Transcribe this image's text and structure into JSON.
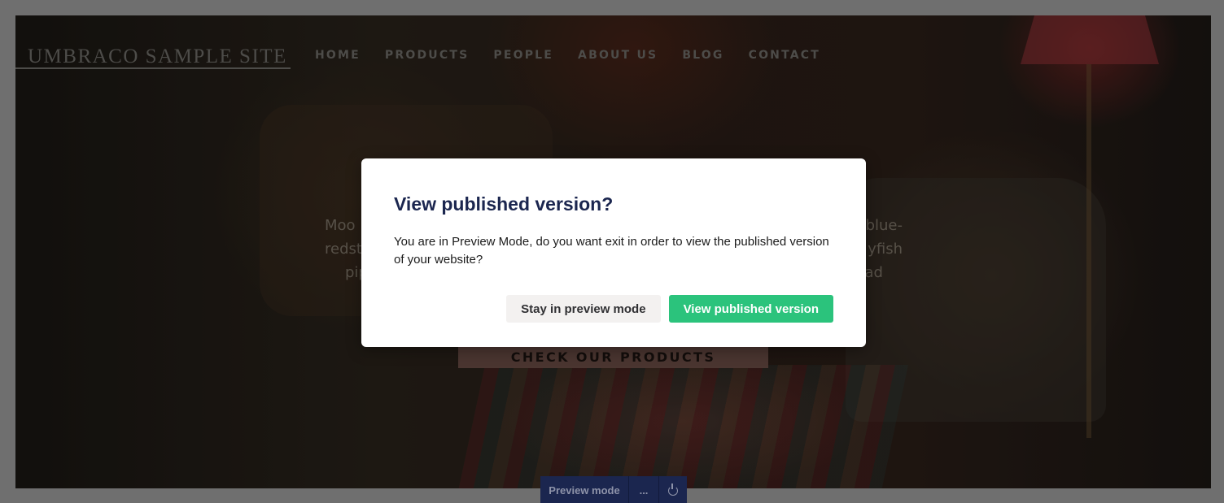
{
  "site": {
    "title": "UMBRACO SAMPLE SITE",
    "nav": [
      "HOME",
      "PRODUCTS",
      "PEOPLE",
      "ABOUT US",
      "BLOG",
      "CONTACT"
    ],
    "hero_text_line1_left": "Moo",
    "hero_text_line1_right": "blue-",
    "hero_text_line2_left": "redst",
    "hero_text_line2_right": "yfish",
    "hero_text_line3_left": "pip",
    "hero_text_line3_right": "ad",
    "cta_label": "CHECK OUR PRODUCTS"
  },
  "dialog": {
    "title": "View published version?",
    "body": "You are in Preview Mode, do you want exit in order to view the published version of your website?",
    "secondary_label": "Stay in preview mode",
    "primary_label": "View published version"
  },
  "preview_bar": {
    "label": "Preview mode",
    "more_label": "...",
    "exit_icon": "power-icon"
  },
  "colors": {
    "dialog_title": "#1b264f",
    "primary_button": "#2bc37c",
    "preview_bar_bg": "#1b264f"
  }
}
